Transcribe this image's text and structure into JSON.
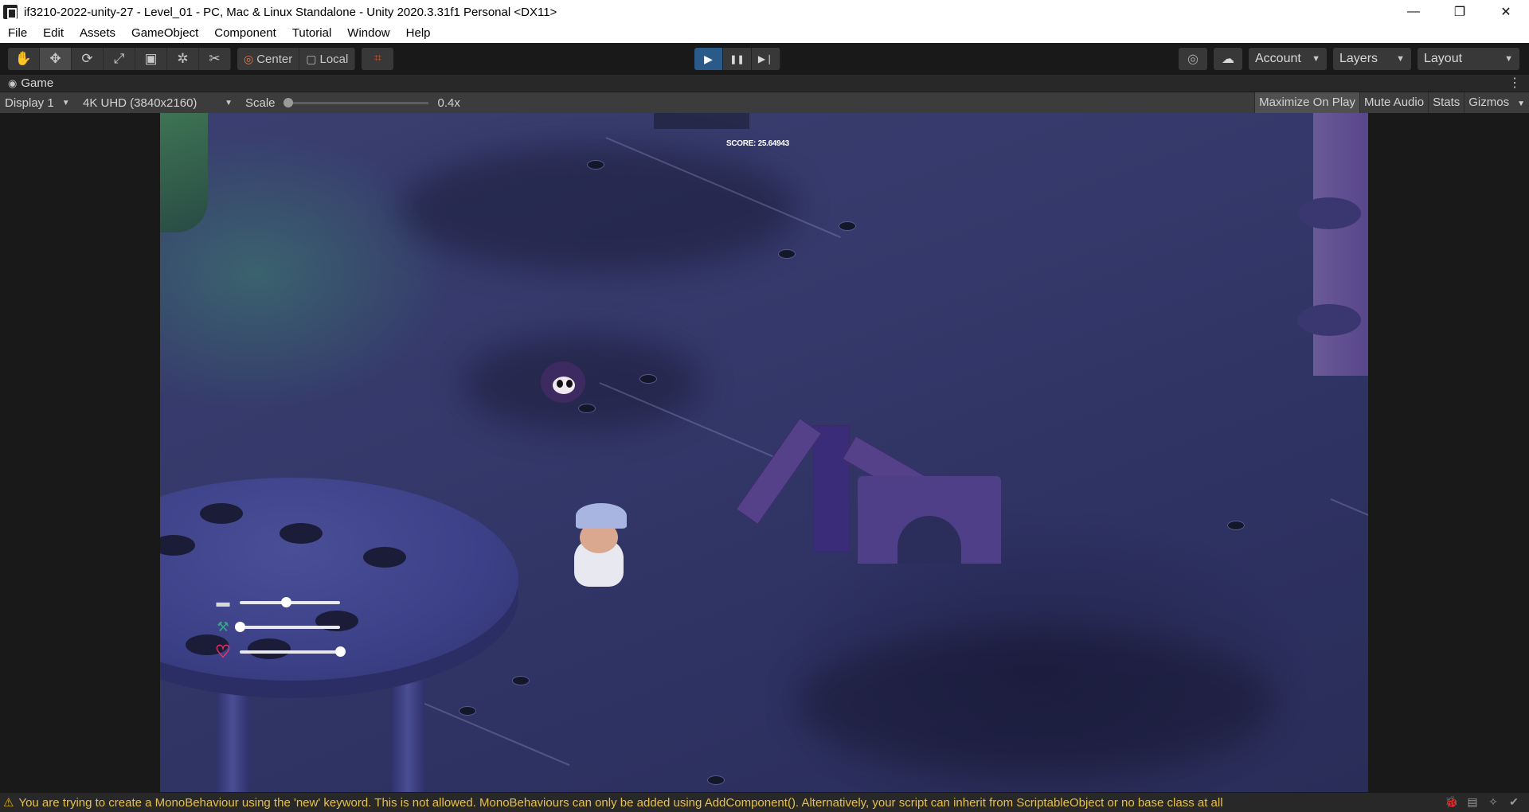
{
  "window": {
    "title": "if3210-2022-unity-27 - Level_01 - PC, Mac & Linux Standalone - Unity 2020.3.31f1 Personal <DX11>",
    "minimize_glyph": "—",
    "restore_glyph": "❐",
    "close_glyph": "✕"
  },
  "menu": [
    "File",
    "Edit",
    "Assets",
    "GameObject",
    "Component",
    "Tutorial",
    "Window",
    "Help"
  ],
  "toolbar": {
    "tools": [
      {
        "name": "hand-tool",
        "glyph": "✋"
      },
      {
        "name": "move-tool",
        "glyph": "✥"
      },
      {
        "name": "rotate-tool",
        "glyph": "⟳"
      },
      {
        "name": "scale-tool",
        "glyph": "⤢"
      },
      {
        "name": "rect-tool",
        "glyph": "▣"
      },
      {
        "name": "transform-tool",
        "glyph": "✲"
      },
      {
        "name": "custom-tool",
        "glyph": "✂"
      }
    ],
    "pivot": "Center",
    "space": "Local",
    "grid_glyph": "⌗",
    "play_glyph": "▶",
    "pause_glyph": "❚❚",
    "step_glyph": "▶❘",
    "collab_glyph": "◎",
    "cloud_glyph": "☁",
    "account_label": "Account",
    "layers_label": "Layers",
    "layout_label": "Layout",
    "caret": "▼"
  },
  "game_tab": {
    "label": "Game",
    "icon_glyph": "👁",
    "menu_glyph": "⋮"
  },
  "game_toolbar": {
    "display": "Display 1",
    "resolution": "4K UHD (3840x2160)",
    "scale_label": "Scale",
    "scale_value": "0.4x",
    "scale_fraction": 0.0,
    "maximize_on_play": "Maximize On Play",
    "mute_audio": "Mute Audio",
    "stats": "Stats",
    "gizmos": "Gizmos"
  },
  "game": {
    "score_text": "SCORE: 25.64943",
    "hud": [
      {
        "name": "weapon",
        "glyph": "▬",
        "color": "#d8d8d8",
        "fraction": 0.46
      },
      {
        "name": "wrench",
        "glyph": "⚒",
        "color": "#3aa38a",
        "fraction": 0.0
      },
      {
        "name": "heart",
        "glyph": "♡",
        "color": "#e8336a",
        "fraction": 1.0
      }
    ]
  },
  "status": {
    "warning_glyph": "⚠",
    "message": "You are trying to create a MonoBehaviour using the 'new' keyword.  This is not allowed.  MonoBehaviours can only be added using AddComponent(). Alternatively, your script can inherit from ScriptableObject or no base class at all",
    "icons": [
      "🐞",
      "▤",
      "✧",
      "✔"
    ]
  },
  "colors": {
    "editor_bg": "#191919",
    "play_active": "#2a5a8a",
    "warning": "#e6c04a"
  }
}
